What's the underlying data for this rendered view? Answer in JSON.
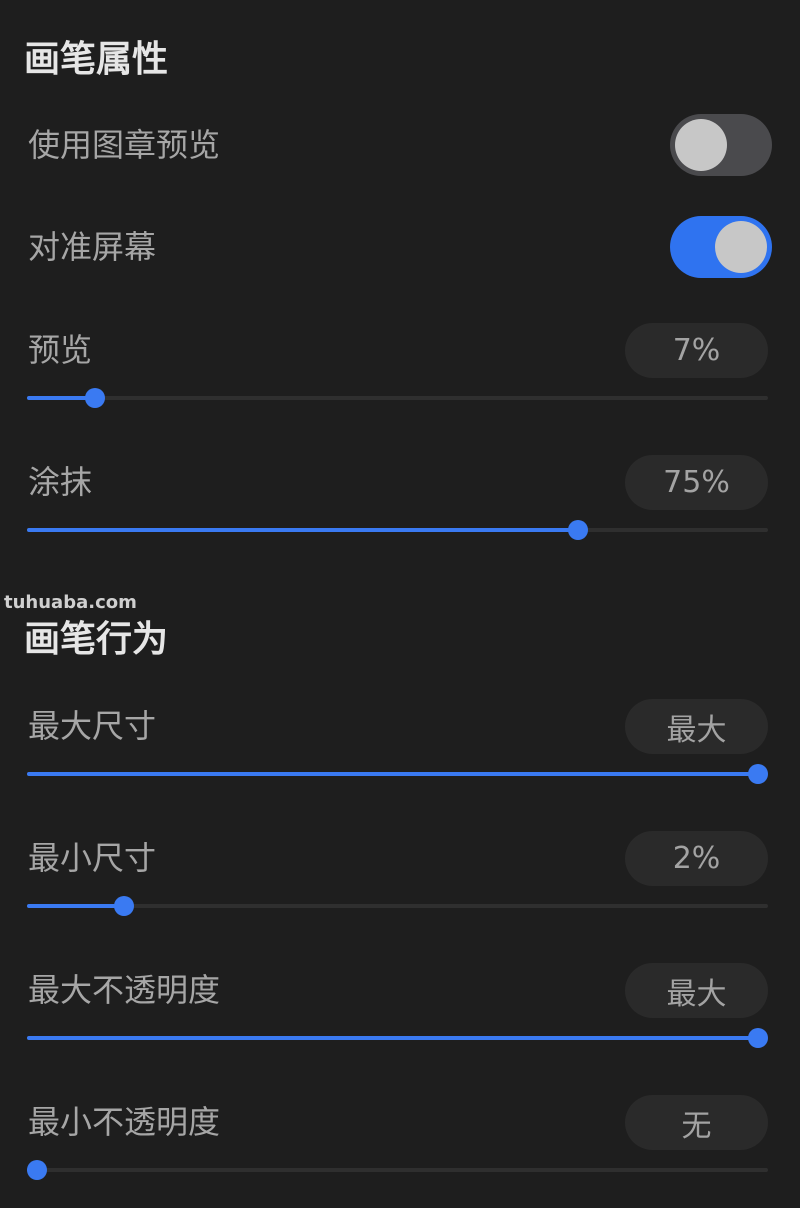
{
  "brush_properties": {
    "title": "画笔属性",
    "rows": [
      {
        "label": "使用图章预览",
        "type": "toggle",
        "on": false
      },
      {
        "label": "对准屏幕",
        "type": "toggle",
        "on": true
      },
      {
        "label": "预览",
        "type": "slider",
        "value_text": "7%",
        "level": 0.08
      },
      {
        "label": "涂抹",
        "type": "slider",
        "value_text": "75%",
        "level": 0.75
      }
    ]
  },
  "watermark": "tuhuaba.com",
  "brush_behavior": {
    "title": "画笔行为",
    "rows": [
      {
        "label": "最大尺寸",
        "value_text": "最大",
        "level": 1.0
      },
      {
        "label": "最小尺寸",
        "value_text": "2%",
        "level": 0.12
      },
      {
        "label": "最大不透明度",
        "value_text": "最大",
        "level": 1.0
      },
      {
        "label": "最小不透明度",
        "value_text": "无",
        "level": 0.0
      }
    ]
  },
  "colors": {
    "background": "#1e1e1e",
    "accent": "#2f73f0",
    "toggle_off": "#4a4a4d",
    "pill_bg": "#2a2a2a"
  }
}
